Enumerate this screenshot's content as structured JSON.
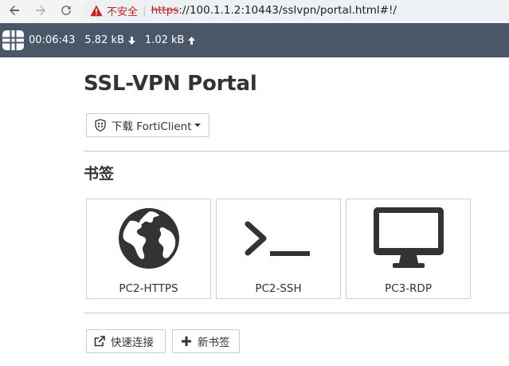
{
  "browser": {
    "back_icon": "back-arrow-icon",
    "forward_icon": "forward-arrow-icon",
    "reload_icon": "reload-icon",
    "security_label": "不安全",
    "url_scheme": "https",
    "url_rest": "://100.1.1.2:10443/sslvpn/portal.html#!/"
  },
  "topbar": {
    "logo": "fortinet-logo",
    "session_time": "00:06:43",
    "download": "5.82 kB",
    "upload": "1.02 kB",
    "background_color": "#4a5768"
  },
  "page": {
    "title": "SSL-VPN Portal",
    "download_button": "下载 FortiClient",
    "bookmarks_heading": "书签",
    "bookmarks": [
      {
        "label": "PC2-HTTPS",
        "icon": "globe-icon"
      },
      {
        "label": "PC2-SSH",
        "icon": "terminal-icon"
      },
      {
        "label": "PC3-RDP",
        "icon": "monitor-icon"
      }
    ],
    "quick_connect_button": "快速连接",
    "new_bookmark_button": "新书签"
  }
}
